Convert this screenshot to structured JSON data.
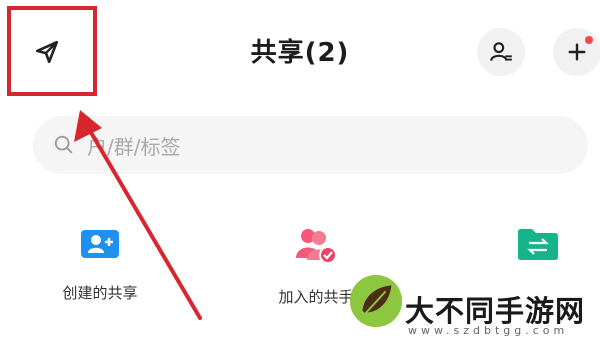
{
  "header": {
    "title": "共享(2)",
    "left_icon": "send-icon",
    "right_icons": [
      "contacts-icon",
      "add-icon"
    ]
  },
  "search": {
    "placeholder": "用户/群/标签",
    "visible_text": "户/群/标签"
  },
  "categories": [
    {
      "label": "创建的共享",
      "icon": "add-user-card-icon",
      "color": "#1e90f0"
    },
    {
      "label": "加入的共享",
      "visible_label": "加入的共手",
      "icon": "users-check-icon",
      "color": "#f25a78"
    },
    {
      "label": "",
      "icon": "folder-swap-icon",
      "color": "#16b48a"
    }
  ],
  "annotation": {
    "color": "#d7262e"
  },
  "watermark": {
    "name": "大不同手游网",
    "url": "www.szdbtgg.com"
  },
  "colors": {
    "accent_red": "#f24a4a",
    "background": "#ffffff"
  }
}
